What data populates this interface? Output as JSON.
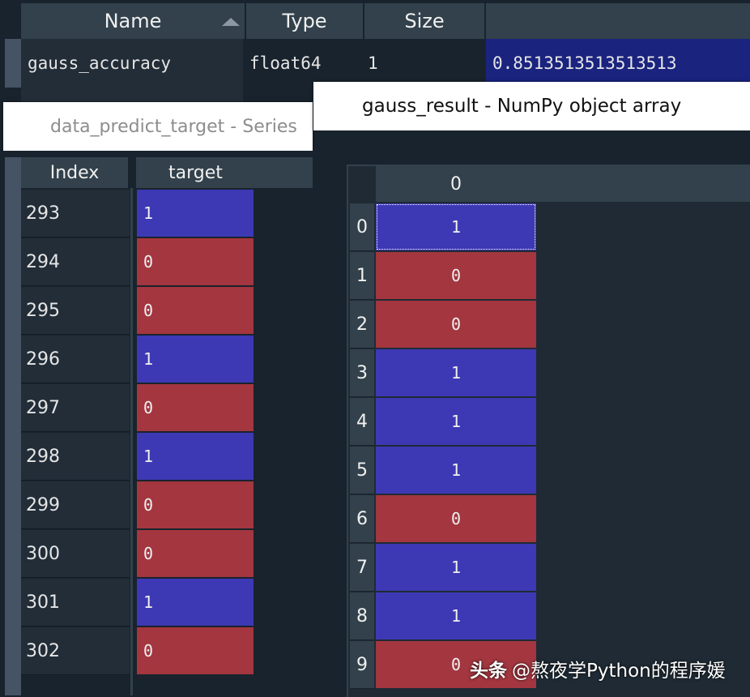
{
  "variable_explorer": {
    "columns": [
      "Name",
      "Type",
      "Size",
      ""
    ],
    "row": {
      "name": "gauss_accuracy",
      "type": "float64",
      "size": "1",
      "value": "0.8513513513513513"
    }
  },
  "series_editor": {
    "title": "data_predict_target - Series",
    "index_header": "Index",
    "value_header": "target",
    "rows": [
      {
        "index": "293",
        "value": "1"
      },
      {
        "index": "294",
        "value": "0"
      },
      {
        "index": "295",
        "value": "0"
      },
      {
        "index": "296",
        "value": "1"
      },
      {
        "index": "297",
        "value": "0"
      },
      {
        "index": "298",
        "value": "1"
      },
      {
        "index": "299",
        "value": "0"
      },
      {
        "index": "300",
        "value": "0"
      },
      {
        "index": "301",
        "value": "1"
      },
      {
        "index": "302",
        "value": "0"
      }
    ]
  },
  "array_editor": {
    "title": "gauss_result - NumPy object array",
    "column_header": "0",
    "rows": [
      {
        "index": "0",
        "value": "1"
      },
      {
        "index": "1",
        "value": "0"
      },
      {
        "index": "2",
        "value": "0"
      },
      {
        "index": "3",
        "value": "1"
      },
      {
        "index": "4",
        "value": "1"
      },
      {
        "index": "5",
        "value": "1"
      },
      {
        "index": "6",
        "value": "0"
      },
      {
        "index": "7",
        "value": "1"
      },
      {
        "index": "8",
        "value": "1"
      },
      {
        "index": "9",
        "value": "0"
      }
    ]
  },
  "watermark": {
    "brand": "头条",
    "handle": "@熬夜学Python的程序媛"
  },
  "colors": {
    "value_one": "#3d39b4",
    "value_zero": "#a3363f",
    "selection": "#1a237e"
  }
}
